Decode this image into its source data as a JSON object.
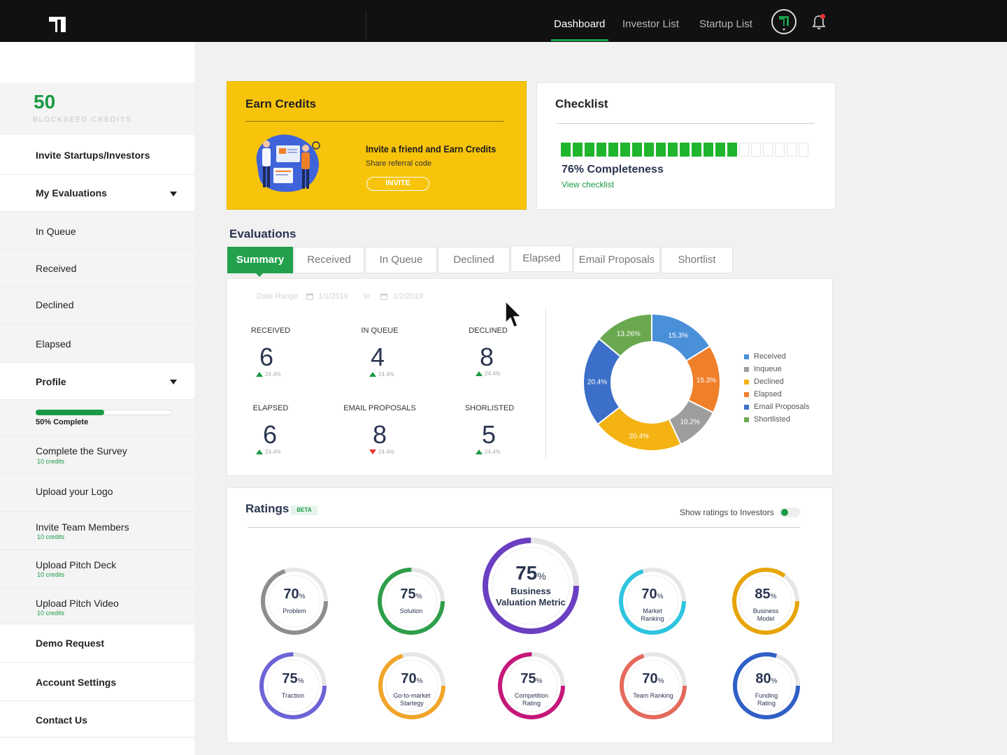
{
  "nav": {
    "links": [
      "Dashboard",
      "Investor List",
      "Startup List"
    ]
  },
  "sidebar": {
    "credits": "50",
    "credits_label": "BLOCKSEED CREDITS",
    "invite": "Invite Startups/Investors",
    "my_evaluations": "My Evaluations",
    "eval_items": [
      "In Queue",
      "Received",
      "Declined",
      "Elapsed"
    ],
    "profile": "Profile",
    "profile_progress": 0.5,
    "profile_complete": "50% Complete",
    "tasks": [
      {
        "label": "Complete the Survey",
        "credits": "10 credits"
      },
      {
        "label": "Upload your Logo",
        "credits": ""
      },
      {
        "label": "Invite Team Members",
        "credits": "10 credits"
      },
      {
        "label": "Upload Pitch Deck",
        "credits": "10 credits"
      },
      {
        "label": "Upload Pitch Video",
        "credits": "10 credits"
      }
    ],
    "bottom": [
      "Demo Request",
      "Account Settings",
      "Contact Us"
    ]
  },
  "earn": {
    "title": "Earn Credits",
    "headline": "Invite a friend and Earn Credits",
    "sub": "Share referral code",
    "button": "INVITE"
  },
  "checklist": {
    "title": "Checklist",
    "filled": 15,
    "total": 21,
    "completeness": "76% Completeness",
    "link": "View checklist"
  },
  "evaluations": {
    "title": "Evaluations",
    "tabs": [
      "Summary",
      "Received",
      "In Queue",
      "Declined",
      "Elapsed",
      "Email Proposals",
      "Shortlist"
    ],
    "date_range_label": "Date Range",
    "date_from": "1/1/2019",
    "date_to_label": "to",
    "date_to": "1/2/2019",
    "stats": [
      {
        "label": "RECEIVED",
        "value": "6",
        "delta": "24.4%",
        "dir": "up"
      },
      {
        "label": "IN QUEUE",
        "value": "4",
        "delta": "24.4%",
        "dir": "up"
      },
      {
        "label": "DECLINED",
        "value": "8",
        "delta": "24.4%",
        "dir": "up"
      },
      {
        "label": "ELAPSED",
        "value": "6",
        "delta": "24.4%",
        "dir": "up"
      },
      {
        "label": "EMAIL PROPOSALS",
        "value": "8",
        "delta": "24.4%",
        "dir": "down"
      },
      {
        "label": "SHORLISTED",
        "value": "5",
        "delta": "24.4%",
        "dir": "up"
      }
    ]
  },
  "chart_data": {
    "type": "pie",
    "categories": [
      "Received",
      "Inqueue",
      "Declined",
      "Elapsed",
      "Email Proposals",
      "Shortlisted"
    ],
    "slices": [
      {
        "name": "Received",
        "value": 15.3,
        "color": "#4a90d9"
      },
      {
        "name": "Declined",
        "value": 15.3,
        "color": "#f07f2a"
      },
      {
        "name": "Inqueue",
        "value": 10.2,
        "color": "#9e9e9e"
      },
      {
        "name": "Elapsed",
        "value": 20.4,
        "color": "#f4b312"
      },
      {
        "name": "Email Proposals",
        "value": 20.4,
        "color": "#3b6fc9"
      },
      {
        "name": "Shortlisted",
        "value": 13.26,
        "color": "#6aa84f"
      }
    ],
    "legend": [
      {
        "name": "Received",
        "color": "#4a90d9"
      },
      {
        "name": "Inqueue",
        "color": "#9e9e9e"
      },
      {
        "name": "Declined",
        "color": "#f4b312"
      },
      {
        "name": "Elapsed",
        "color": "#f07f2a"
      },
      {
        "name": "Email Proposals",
        "color": "#3b6fc9"
      },
      {
        "name": "Shortlisted",
        "color": "#6aa84f"
      }
    ],
    "legend_position": "right"
  },
  "ratings": {
    "title": "Ratings",
    "badge": "BETA",
    "toggle_label": "Show ratings to Investors",
    "items": [
      {
        "value": "70",
        "unit": "%",
        "label": "Problem",
        "pct": 70,
        "color": "#8e8e8e"
      },
      {
        "value": "75",
        "unit": "%",
        "label": "Solution",
        "pct": 75,
        "color": "#2e9e4a"
      },
      {
        "value": "75",
        "unit": "%",
        "label": "Business Valuation Metric",
        "pct": 75,
        "color": "#6a3fc1"
      },
      {
        "value": "70",
        "unit": "%",
        "label": "Market Ranking",
        "pct": 70,
        "color": "#2ec5df"
      },
      {
        "value": "85",
        "unit": "%",
        "label": "Business Model",
        "pct": 85,
        "color": "#e8a50a"
      },
      {
        "value": "75",
        "unit": "%",
        "label": "Traction",
        "pct": 75,
        "color": "#6c63d6"
      },
      {
        "value": "70",
        "unit": "%",
        "label": "Go-to-market Startegy",
        "pct": 70,
        "color": "#f0a52a"
      },
      {
        "value": "75",
        "unit": "%",
        "label": "Competition Rating",
        "pct": 75,
        "color": "#c6177a"
      },
      {
        "value": "70",
        "unit": "%",
        "label": "Team Ranking",
        "pct": 70,
        "color": "#e46a5c"
      },
      {
        "value": "80",
        "unit": "%",
        "label": "Funding Rating",
        "pct": 80,
        "color": "#2f5fc7"
      }
    ]
  }
}
